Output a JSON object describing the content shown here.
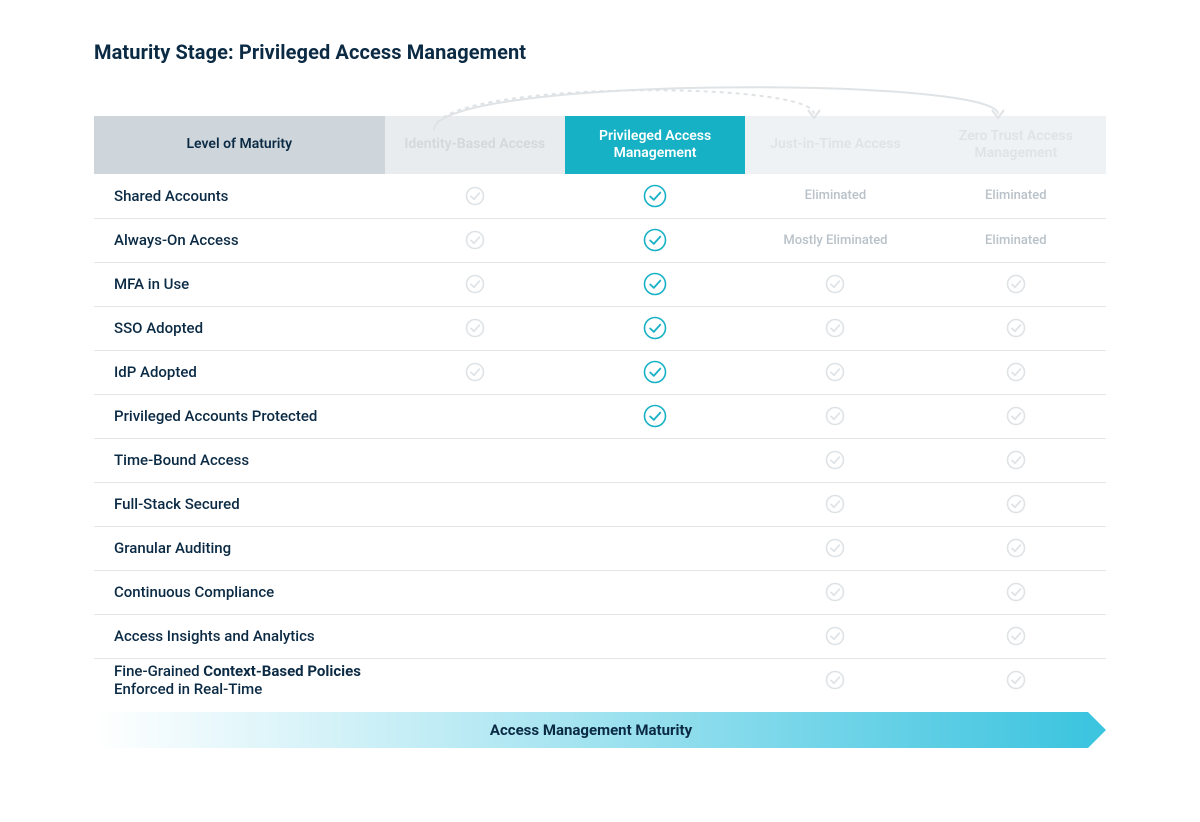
{
  "title": "Maturity Stage: Privileged Access Management",
  "columns": {
    "label": "Level of Maturity",
    "c1": "Identity-Based Access",
    "c2": "Privileged Access Management",
    "c3": "Just-in-Time Access",
    "c4": "Zero Trust Access Management"
  },
  "active_column_index": 2,
  "rows": [
    {
      "label": "Shared Accounts",
      "cells": [
        "check-grey",
        "check-teal",
        "text:Eliminated",
        "text:Eliminated"
      ]
    },
    {
      "label": "Always-On Access",
      "cells": [
        "check-grey",
        "check-teal",
        "text:Mostly Eliminated",
        "text:Eliminated"
      ]
    },
    {
      "label": "MFA in Use",
      "cells": [
        "check-grey",
        "check-teal",
        "check-grey",
        "check-grey"
      ]
    },
    {
      "label": "SSO Adopted",
      "cells": [
        "check-grey",
        "check-teal",
        "check-grey",
        "check-grey"
      ]
    },
    {
      "label": "IdP Adopted",
      "cells": [
        "check-grey",
        "check-teal",
        "check-grey",
        "check-grey"
      ]
    },
    {
      "label": "Privileged Accounts Protected",
      "cells": [
        "empty",
        "check-teal",
        "check-grey",
        "check-grey"
      ]
    },
    {
      "label": "Time-Bound Access",
      "cells": [
        "empty",
        "empty",
        "check-grey",
        "check-grey"
      ]
    },
    {
      "label": "Full-Stack Secured",
      "cells": [
        "empty",
        "empty",
        "check-grey",
        "check-grey"
      ]
    },
    {
      "label": "Granular Auditing",
      "cells": [
        "empty",
        "empty",
        "check-grey",
        "check-grey"
      ]
    },
    {
      "label": "Continuous Compliance",
      "cells": [
        "empty",
        "empty",
        "check-grey",
        "check-grey"
      ]
    },
    {
      "label": "Access Insights and Analytics",
      "cells": [
        "empty",
        "empty",
        "check-grey",
        "check-grey"
      ]
    },
    {
      "label_html": "Fine-Grained <b>Context-Based Policies</b> Enforced in Real-Time",
      "label": "Fine-Grained Context-Based Policies Enforced in Real-Time",
      "cells": [
        "empty",
        "empty",
        "check-grey",
        "check-grey"
      ]
    }
  ],
  "footer": "Access Management Maturity",
  "colors": {
    "accent": "#17b1c6",
    "ink": "#0b2a44"
  }
}
